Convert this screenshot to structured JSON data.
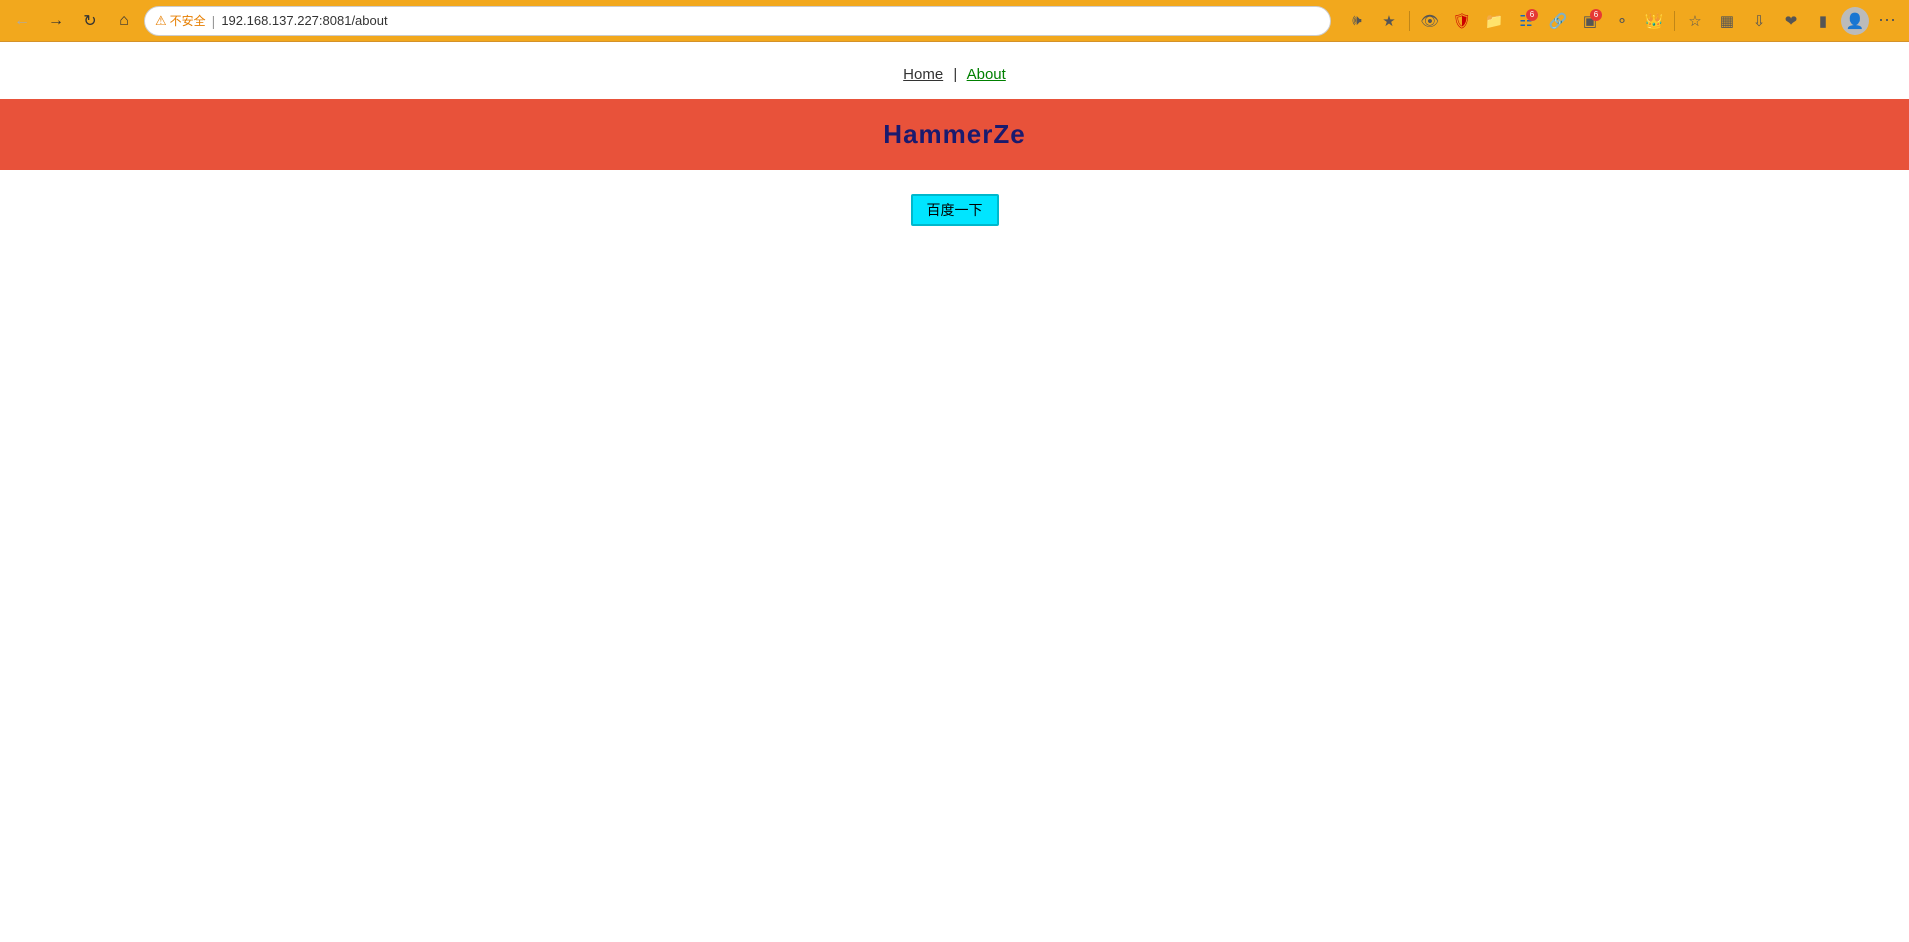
{
  "browser": {
    "back_title": "Back",
    "forward_title": "Forward",
    "reload_title": "Reload",
    "home_title": "Home",
    "security_label": "不安全",
    "address": "192.168.137.227:8081/about",
    "profile_title": "Profile",
    "more_title": "More"
  },
  "nav": {
    "home_label": "Home",
    "about_label": "About",
    "separator": "|"
  },
  "header": {
    "title": "HammerZe"
  },
  "main": {
    "baidu_btn_label": "百度一下"
  }
}
